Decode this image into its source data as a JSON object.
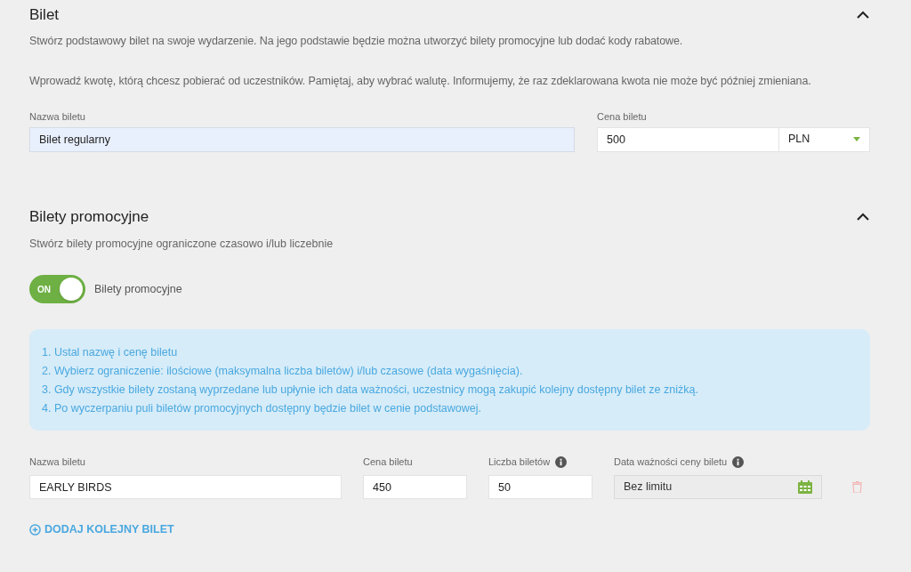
{
  "basic_ticket": {
    "title": "Bilet",
    "expanded": true,
    "descriptions": [
      "Stwórz podstawowy bilet na swoje wydarzenie. Na jego podstawie będzie można utworzyć bilety promocyjne lub dodać kody rabatowe.",
      "Wprowadź kwotę, którą chcesz pobierać od uczestników. Pamiętaj, aby wybrać walutę. Informujemy, że raz zdeklarowana kwota nie może być później zmieniana."
    ],
    "name_label": "Nazwa biletu",
    "name_value": "Bilet regularny",
    "price_label": "Cena biletu",
    "price_value": "500",
    "currency": "PLN"
  },
  "promo_tickets": {
    "title": "Bilety promocyjne",
    "expanded": true,
    "description": "Stwórz bilety promocyjne ograniczone czasowo i/lub liczebnie",
    "toggle": {
      "on": true,
      "on_text": "ON",
      "label": "Bilety promocyjne"
    },
    "info_steps": [
      "1. Ustal nazwę i cenę biletu",
      "2. Wybierz ograniczenie: ilościowe (maksymalna liczba biletów) i/lub czasowe (data wygaśnięcia).",
      "3. Gdy wszystkie bilety zostaną wyprzedane lub upłynie ich data ważności, uczestnicy mogą zakupić kolejny dostępny bilet ze zniżką.",
      "4. Po wyczerpaniu puli biletów promocyjnych dostępny będzie bilet w cenie podstawowej."
    ],
    "columns": [
      {
        "label": "Nazwa biletu",
        "info": false
      },
      {
        "label": "Cena biletu",
        "info": false
      },
      {
        "label": "Liczba biletów",
        "info": true
      },
      {
        "label": "Data ważności ceny biletu",
        "info": true
      }
    ],
    "rows": [
      {
        "name": "EARLY BIRDS",
        "price": "450",
        "count": "50",
        "expiry": "Bez limitu"
      }
    ],
    "add_button": "DODAJ KOLEJNY BILET"
  }
}
